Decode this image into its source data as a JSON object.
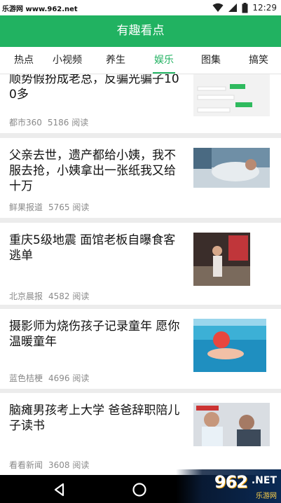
{
  "status_bar": {
    "watermark": "乐游网 www.962.net",
    "time": "12:29"
  },
  "header": {
    "title": "有趣看点"
  },
  "tabs": [
    {
      "label": "热点",
      "active": false
    },
    {
      "label": "小视频",
      "active": false
    },
    {
      "label": "养生",
      "active": false
    },
    {
      "label": "娱乐",
      "active": true
    },
    {
      "label": "图集",
      "active": false
    },
    {
      "label": "搞笑",
      "active": false
    }
  ],
  "feed": {
    "items": [
      {
        "title": "顺势假扮成老总，反骗光骗子100多",
        "source": "都市360",
        "reads": "5186 阅读"
      },
      {
        "title": "父亲去世，遗产都给小姨，我不服去抢，小姨拿出一张纸我又给十万",
        "source": "鲜果报道",
        "reads": "5765 阅读"
      },
      {
        "title": "重庆5级地震 面馆老板自曝食客逃单",
        "source": "北京晨报",
        "reads": "4582 阅读"
      },
      {
        "title": "摄影师为烧伤孩子记录童年 愿你温暖童年",
        "source": "蓝色桔梗",
        "reads": "4696 阅读"
      },
      {
        "title": "脑瘫男孩考上大学 爸爸辞职陪儿子读书",
        "source": "看看新闻",
        "reads": "3608 阅读"
      }
    ]
  },
  "watermark_brand": {
    "big": "962",
    "net": ".NET",
    "small": "乐游网"
  },
  "colors": {
    "accent": "#21b261"
  }
}
